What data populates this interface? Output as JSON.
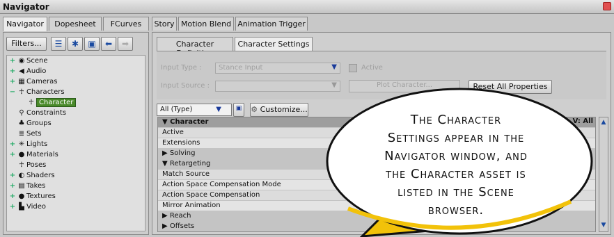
{
  "window": {
    "title": "Navigator"
  },
  "main_tabs": [
    "Navigator",
    "Dopesheet",
    "FCurves",
    "Story",
    "Motion Blend",
    "Animation Trigger"
  ],
  "left": {
    "filters_label": "Filters...",
    "tree": [
      {
        "label": "Scene",
        "icon": "scene-icon",
        "glyph": "+"
      },
      {
        "label": "Audio",
        "icon": "audio-icon",
        "glyph": "+"
      },
      {
        "label": "Cameras",
        "icon": "camera-icon",
        "glyph": "+"
      },
      {
        "label": "Characters",
        "icon": "character-icon",
        "glyph": "−"
      },
      {
        "label": "Character",
        "icon": "character-icon",
        "glyph": "",
        "selected": true
      },
      {
        "label": "Constraints",
        "icon": "constraint-icon",
        "glyph": ""
      },
      {
        "label": "Groups",
        "icon": "group-icon",
        "glyph": ""
      },
      {
        "label": "Sets",
        "icon": "set-icon",
        "glyph": ""
      },
      {
        "label": "Lights",
        "icon": "light-icon",
        "glyph": "+"
      },
      {
        "label": "Materials",
        "icon": "material-icon",
        "glyph": "+"
      },
      {
        "label": "Poses",
        "icon": "pose-icon",
        "glyph": ""
      },
      {
        "label": "Shaders",
        "icon": "shader-icon",
        "glyph": "+"
      },
      {
        "label": "Takes",
        "icon": "take-icon",
        "glyph": "+"
      },
      {
        "label": "Textures",
        "icon": "texture-icon",
        "glyph": "+"
      },
      {
        "label": "Video",
        "icon": "video-icon",
        "glyph": "+"
      }
    ]
  },
  "right": {
    "subtabs": [
      "Character Definition",
      "Character Settings"
    ],
    "input_type_label": "Input Type :",
    "input_type_value": "Stance Input",
    "active_label": "Active",
    "input_source_label": "Input Source :",
    "plot_label": "Plot Character...",
    "reset_label": "Reset All Properties",
    "filter_value": "All (Type)",
    "customize_label": "Customize...",
    "v_all": "V: All",
    "properties": [
      {
        "label": "▼ Character",
        "kind": "header"
      },
      {
        "label": "Active",
        "kind": "row"
      },
      {
        "label": "Extensions",
        "kind": "alt"
      },
      {
        "label": "▶ Solving",
        "kind": "section"
      },
      {
        "label": "▼ Retargeting",
        "kind": "section"
      },
      {
        "label": "Match Source",
        "kind": "row"
      },
      {
        "label": "Action Space Compensation Mode",
        "kind": "alt"
      },
      {
        "label": "Action Space Compensation",
        "kind": "row"
      },
      {
        "label": "Mirror Animation",
        "kind": "alt"
      },
      {
        "label": "    ▶ Reach",
        "kind": "section"
      },
      {
        "label": "    ▶ Offsets",
        "kind": "section"
      }
    ]
  },
  "callout": {
    "line1": "The Character",
    "line2": "Settings appear in the",
    "line3": "Navigator window, and",
    "line4": "the Character asset is",
    "line5": "listed in the Scene",
    "line6": "browser."
  },
  "colors": {
    "selection": "#4a8a2a",
    "callout_border": "#111111",
    "callout_accent": "#f2c20a"
  }
}
